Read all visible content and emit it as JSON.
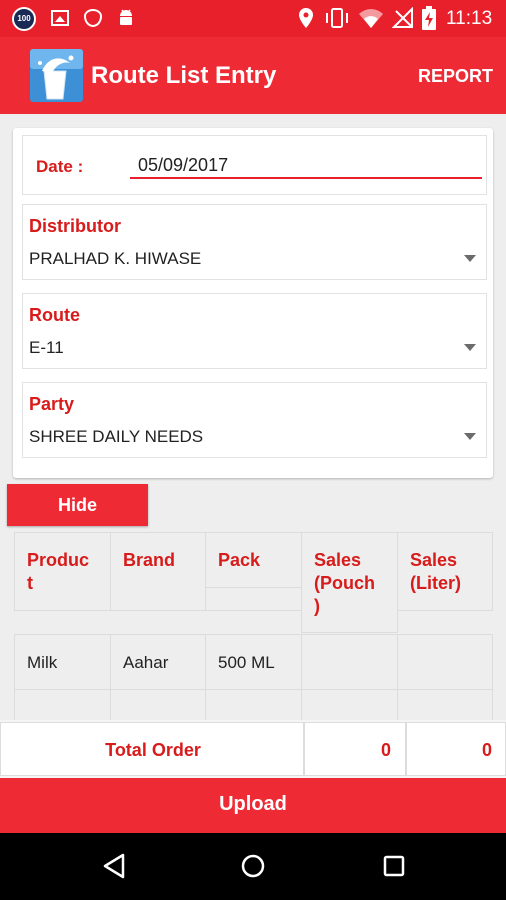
{
  "status_bar": {
    "time": "11:13",
    "notification_badge": "100",
    "icons": [
      "speedometer-icon",
      "image-icon",
      "shield-icon",
      "android-icon",
      "location-pin-icon",
      "vibrate-icon",
      "wifi-icon",
      "no-signal-icon",
      "battery-charging-icon"
    ]
  },
  "app_bar": {
    "title": "Route List Entry",
    "report_label": "REPORT",
    "logo": "milk-splash-logo"
  },
  "form": {
    "date_label": "Date :",
    "date_value": "05/09/2017",
    "distributor_label": "Distributor",
    "distributor_value": "PRALHAD K. HIWASE",
    "route_label": "Route",
    "route_value": "E-11",
    "party_label": "Party",
    "party_value": "SHREE DAILY NEEDS"
  },
  "hide_button": "Hide",
  "table": {
    "headers": [
      "Produc\nt",
      "Brand",
      "Pack",
      "Sales\n(Pouch\n)",
      "Sales\n(Liter)"
    ],
    "rows": [
      [
        "Milk",
        "Aahar",
        "500 ML",
        "",
        ""
      ]
    ]
  },
  "total": {
    "label": "Total Order",
    "pouch": "0",
    "liter": "0"
  },
  "upload_label": "Upload",
  "colors": {
    "primary": "#ee2b35",
    "status_bar": "#e8202b",
    "label_red": "#d81b1b"
  }
}
